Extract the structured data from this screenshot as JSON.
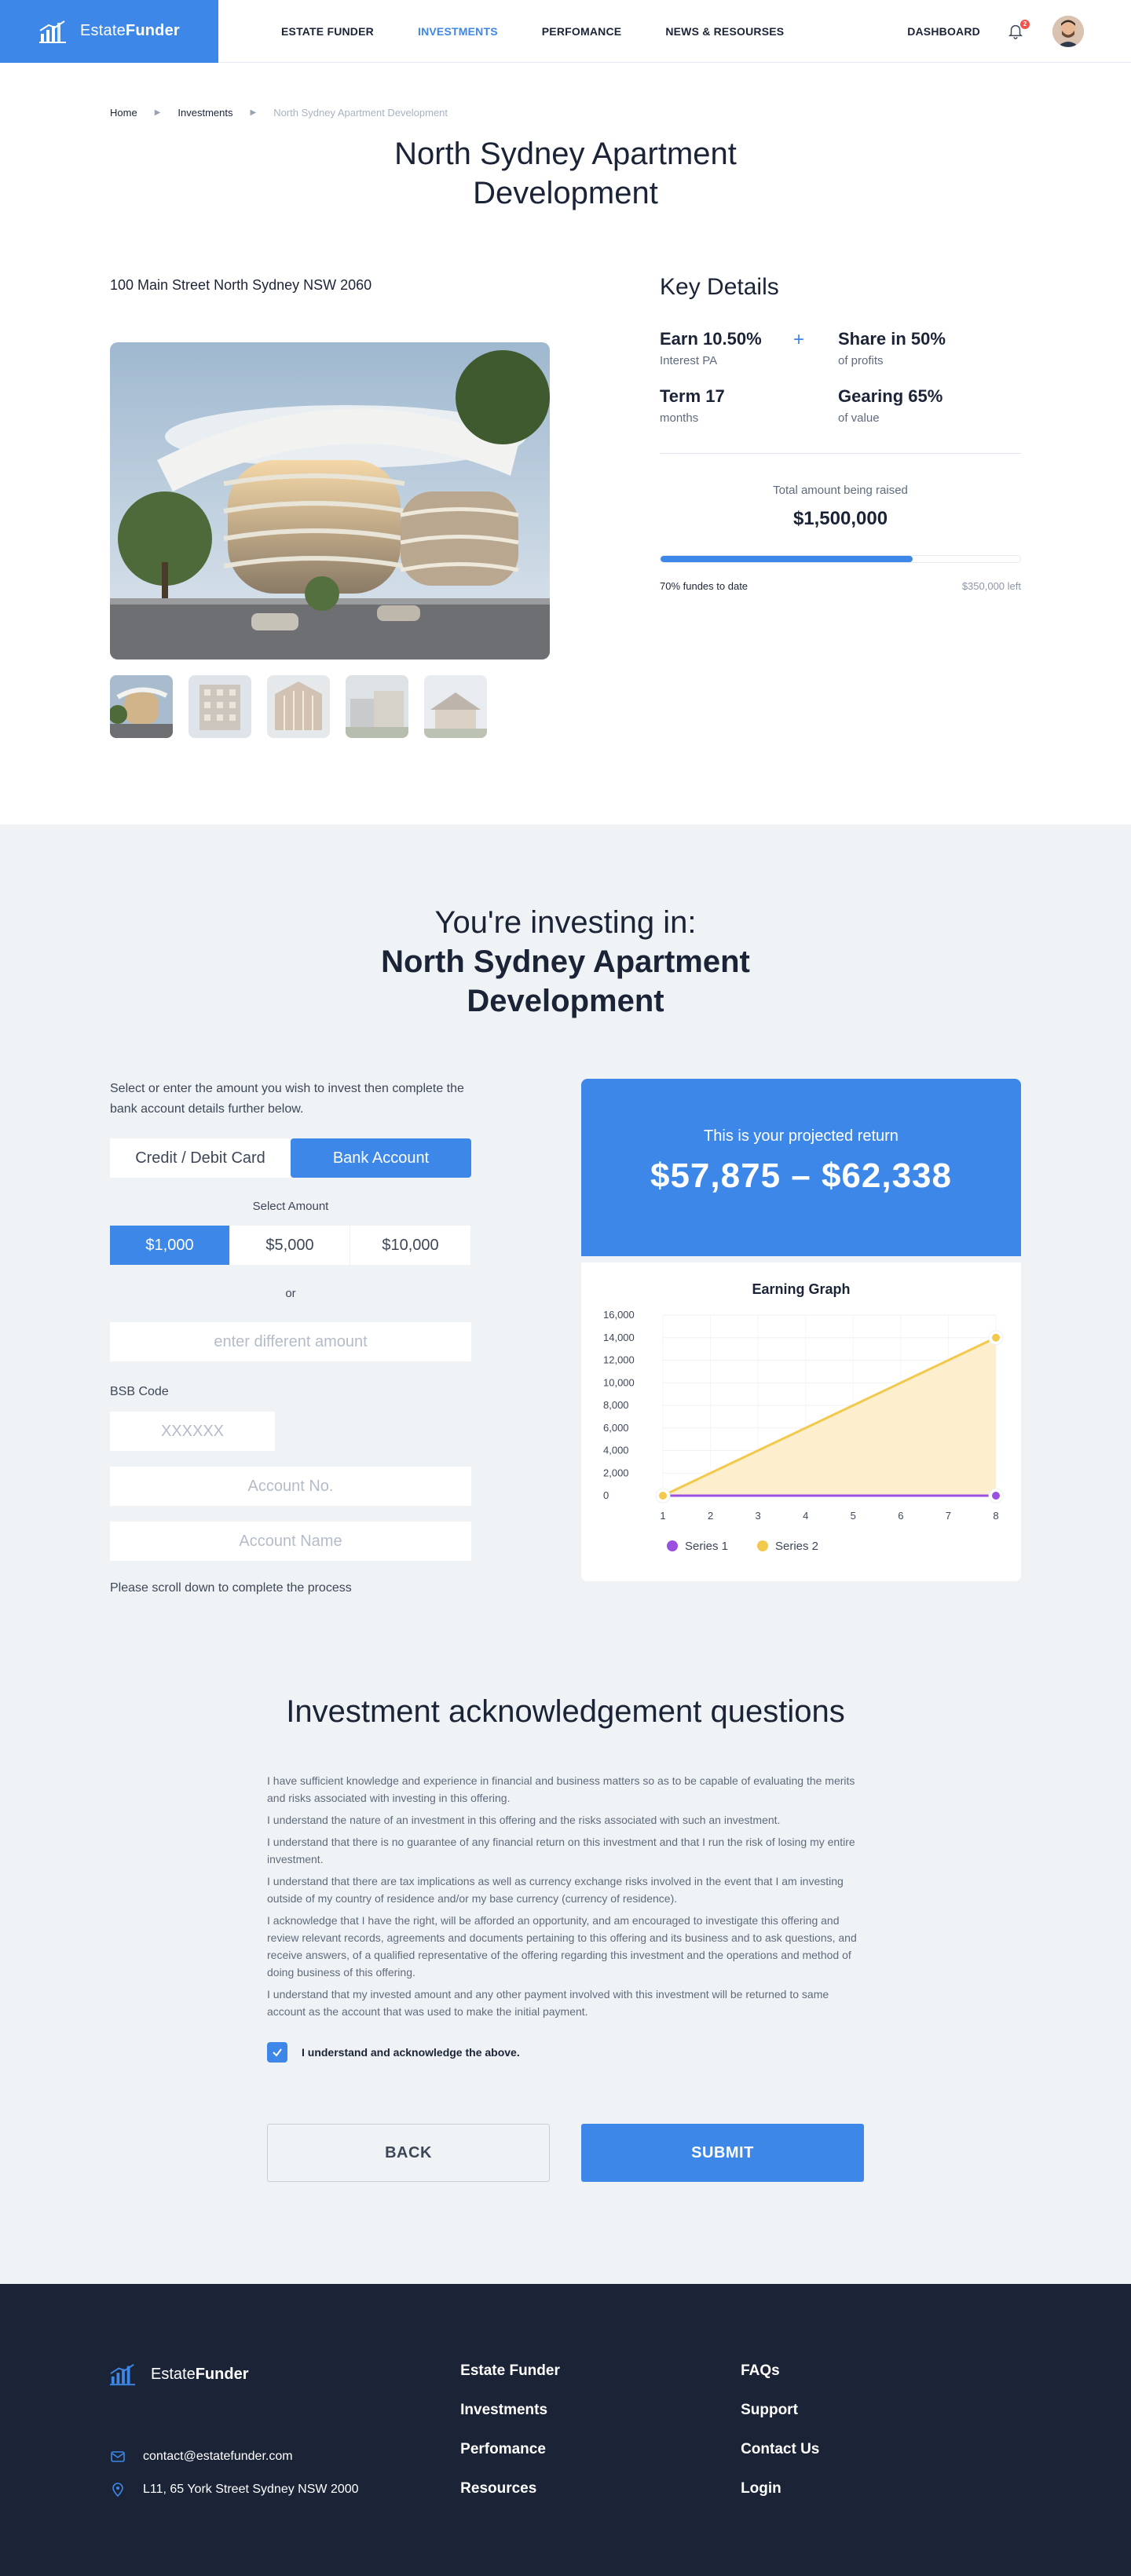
{
  "nav": {
    "brand_light": "Estate",
    "brand_bold": "Funder",
    "links": [
      "ESTATE FUNDER",
      "INVESTMENTS",
      "PERFOMANCE",
      "NEWS & RESOURSES"
    ],
    "dashboard": "DASHBOARD",
    "notification_count": "2"
  },
  "breadcrumb": [
    "Home",
    "Investments",
    "North Sydney Apartment Development"
  ],
  "property": {
    "title": "North Sydney Apartment Development",
    "address": "100 Main Street North Sydney NSW 2060"
  },
  "key_details": {
    "title": "Key Details",
    "earn": "Earn 10.50%",
    "earn_sub": "Interest PA",
    "share": "Share in 50%",
    "share_sub": "of profits",
    "term": "Term 17",
    "term_sub": "months",
    "gearing": "Gearing 65%",
    "gearing_sub": "of value",
    "raise_label": "Total amount being raised",
    "raise_amount": "$1,500,000",
    "progress_pct": 70,
    "progress_label": "70% fundes to date",
    "left_label": "$350,000 left"
  },
  "invest": {
    "sub": "You're investing in:",
    "name": "North Sydney Apartment Development",
    "instruction": "Select or enter the amount you wish to invest then complete the bank account details further below.",
    "tabs": [
      "Credit / Debit Card",
      "Bank Account"
    ],
    "select_label": "Select Amount",
    "amounts": [
      "$1,000",
      "$5,000",
      "$10,000"
    ],
    "or": "or",
    "diff_placeholder": "enter different amount",
    "bsb_label": "BSB Code",
    "bsb_placeholder": "XXXXXX",
    "accno_placeholder": "Account No.",
    "accname_placeholder": "Account Name",
    "scroll_note": "Please scroll down to complete the process"
  },
  "projected": {
    "label": "This is your projected return",
    "value": "$57,875 – $62,338"
  },
  "chart_data": {
    "type": "area",
    "title": "Earning Graph",
    "x": [
      1,
      2,
      3,
      4,
      5,
      6,
      7,
      8
    ],
    "ylim": [
      0,
      16000
    ],
    "yticks": [
      0,
      2000,
      4000,
      6000,
      8000,
      10000,
      12000,
      14000,
      16000
    ],
    "ytick_labels": [
      "0",
      "2,000",
      "4,000",
      "6,000",
      "8,000",
      "10,000",
      "12,000",
      "14,000",
      "16,000"
    ],
    "series": [
      {
        "name": "Series 1",
        "color": "#9b51e0",
        "values": [
          0,
          0,
          0,
          0,
          0,
          0,
          0,
          0
        ]
      },
      {
        "name": "Series 2",
        "color": "#f2c94c",
        "values": [
          0,
          2000,
          4000,
          6000,
          8000,
          10000,
          12000,
          14000
        ]
      }
    ],
    "grid": true,
    "legend": "bottom-left"
  },
  "ack": {
    "title": "Investment acknowledgement questions",
    "paragraphs": [
      "I have sufficient knowledge and experience in financial and business matters so as to be capable of evaluating the merits and risks associated with investing in this offering.",
      "I understand the nature of an investment in this offering and the risks associated with such an investment.",
      "I understand that there is no guarantee of any financial return on this investment and that I run the risk of losing my entire investment.",
      "I understand that there are tax implications as well as currency exchange risks involved in the event that I am investing outside of my country of residence and/or my base currency (currency of residence).",
      "I acknowledge that I have the right, will be afforded an opportunity, and am encouraged to investigate this offering and review relevant records, agreements and documents pertaining to this offering and its business and to ask questions, and receive answers, of a qualified representative of the offering regarding this investment and the operations and method of doing business of this offering.",
      "I understand that my invested amount and any other payment involved with this investment will be returned to same account as the account that was used to make the initial payment."
    ],
    "check_label": "I understand and acknowledge the above.",
    "back": "BACK",
    "submit": "SUBMIT"
  },
  "footer": {
    "brand_light": "Estate",
    "brand_bold": "Funder",
    "email": "contact@estatefunder.com",
    "address": "L11, 65 York Street Sydney NSW 2000",
    "col1": [
      "Estate Funder",
      "Investments",
      "Perfomance",
      "Resources"
    ],
    "col2": [
      "FAQs",
      "Support",
      "Contact Us",
      "Login"
    ]
  },
  "colors": {
    "accent": "#3d87e8",
    "dark": "#1b2437",
    "section_bg": "#f0f3f5",
    "badge": "#f0544c"
  }
}
